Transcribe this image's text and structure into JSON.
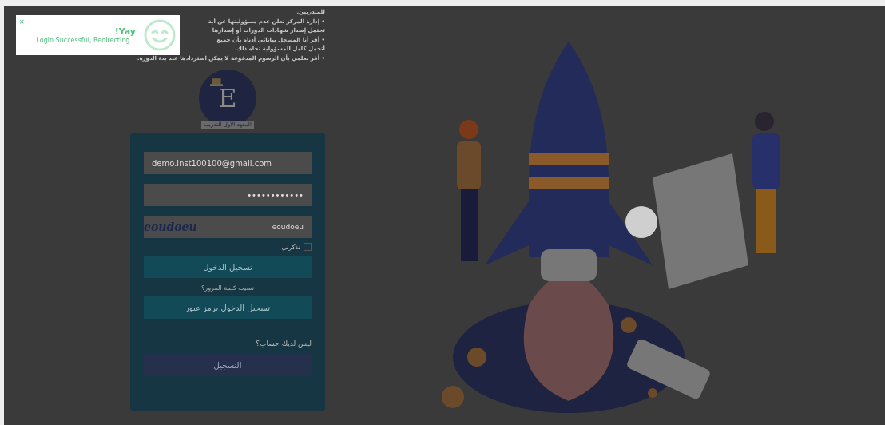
{
  "notice": {
    "lines": [
      "للمتدربين.",
      "• إدارة المركز تعلن عدم مسؤوليتها عن أية",
      "تحتمل إصدار شهادات الدورات أو إصدارها",
      "• أقر أنا المسجل بياناتي أدناه بأن جميع",
      "أتحمل كامل المسؤولية تجاه ذلك.",
      "• أقر بعلمي بأن الرسوم المدفوعة لا يمكن استردادها عند بدء الدورة."
    ]
  },
  "logo": {
    "letter": "E",
    "caption": "المعهد الأول للتدريب"
  },
  "login": {
    "email": "demo.inst100100@gmail.com",
    "password": "••••••••••••",
    "captcha_image": "eoudoeu",
    "captcha_value": "eoudoeu",
    "remember": {
      "label": "تذكرني",
      "checked": false
    },
    "login_button": "تسجيل الدخول",
    "forgot_link": "نسيت كلمة المرور؟",
    "passcode_button": "تسجيل الدخول برمز عبور",
    "no_account": "ليس لديك حساب؟",
    "register_button": "التسجيل"
  },
  "toast": {
    "close": "×",
    "title": "!Yay",
    "message": "Login Successful, Redirecting..."
  }
}
